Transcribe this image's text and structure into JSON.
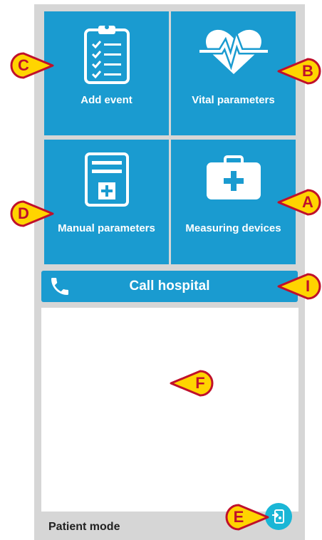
{
  "tiles": [
    {
      "id": "add-event",
      "label": "Add event",
      "icon": "clipboard-checklist-icon"
    },
    {
      "id": "vital-parameters",
      "label": "Vital parameters",
      "icon": "heart-pulse-icon"
    },
    {
      "id": "manual-parameters",
      "label": "Manual parameters",
      "icon": "form-plus-icon"
    },
    {
      "id": "measuring-devices",
      "label": "Measuring devices",
      "icon": "medical-case-icon"
    }
  ],
  "call_button": {
    "label": "Call hospital",
    "icon": "phone-icon"
  },
  "footer": {
    "mode_label": "Patient mode",
    "fab_icon": "settings-login-icon"
  },
  "callouts": {
    "a": "A",
    "b": "B",
    "c": "C",
    "d": "D",
    "e": "E",
    "f": "F",
    "i": "I"
  },
  "colors": {
    "tile_blue": "#1a9bd0",
    "fab_cyan": "#1ab6d6",
    "frame_gray": "#d6d6d6",
    "callout_yellow": "#ffd400",
    "callout_red": "#c0102b"
  }
}
